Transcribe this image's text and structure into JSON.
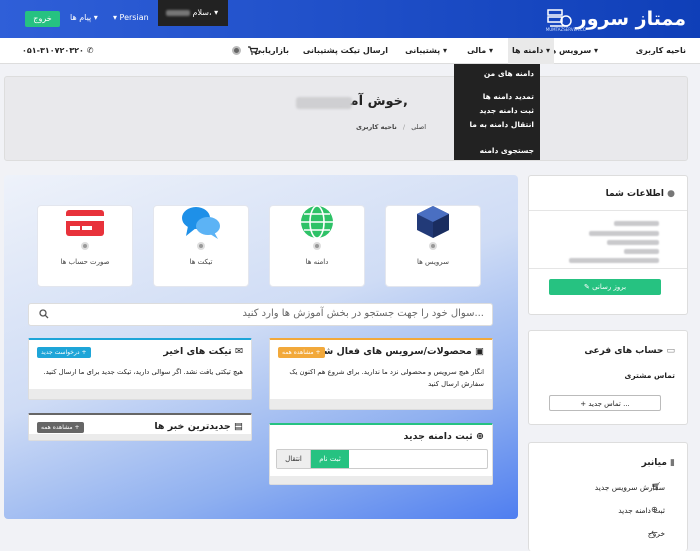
{
  "header": {
    "logo_text": "ممتاز سرور",
    "logo_subtext": "MUMTAZSERVER.CO",
    "logout_label": "خروج",
    "messages_label": "پیام ها ▾",
    "language_label": "▾ Persian"
  },
  "navbar": {
    "items": [
      "ناحیه کاربری",
      "سرویس ها ▾",
      "دامنه ها ▾",
      "مالی ▾",
      "پشتیبانی ▾",
      "ارسال تیکت پشتیبانی",
      "بازاریابی"
    ],
    "hello_label": "سلام، ▾",
    "phone": "۰۵۱-۳۱۰۷۲۰۳۲۰"
  },
  "domain_menu": {
    "items": [
      "دامنه های من",
      "تمدید دامنه ها",
      "ثبت دامنه جدید",
      "انتقال دامنه به ما",
      "جستجوی دامنه"
    ]
  },
  "hero": {
    "welcome": "خوش آمدید,",
    "breadcrumb_home": "اصلی",
    "breadcrumb_sep": "/",
    "breadcrumb_current": "ناحیه کاربری"
  },
  "tiles": [
    {
      "label": "سرویس ها",
      "icon": "cube-icon"
    },
    {
      "label": "دامنه ها",
      "icon": "globe-icon"
    },
    {
      "label": "تیکت ها",
      "icon": "chat-bubbles-icon"
    },
    {
      "label": "صورت حساب ها",
      "icon": "credit-card-icon"
    }
  ],
  "search": {
    "placeholder": "سوال خود را جهت جستجو در بخش آموزش ها وارد کنید..."
  },
  "products_card": {
    "title": "محصولات/سرویس های فعال شما",
    "badge": "مشاهده همه +",
    "body": "انگار هیچ سرویس و محصولی نزد ما ندارید. برای شروع هم اکنون یک سفارش ارسال کنید"
  },
  "tickets_card": {
    "title": "تیکت های اخیر",
    "badge": "درخواست جدید +",
    "body": "هیچ تیکتی یافت نشد. اگر سوالی دارید، تیکت جدید برای ما ارسال کنید."
  },
  "news_card": {
    "title": "جدیدترین خبر ها",
    "badge": "مشاهده همه +"
  },
  "domain_card": {
    "title": "ثبت دامنه جدید",
    "register_label": "ثبت نام",
    "transfer_label": "انتقال"
  },
  "sidebar": {
    "info_title": "اطلاعات شما",
    "update_label": "بروز رسانی",
    "contacts_title": "حساب های فرعی",
    "contact_subtitle": "تماس مشتری",
    "new_contact_label": "+ تماس جدید ...",
    "shortcuts_title": "میانبر",
    "shortcuts": [
      "سفارش سرویس جدید",
      "ثبت دامنه جدید",
      "خروج"
    ]
  },
  "colors": {
    "topbar": "#1f4fc8",
    "green": "#26c281",
    "badge_blue": "#1ea5d8",
    "badge_orange": "#f2a93b",
    "badge_gray": "#666666"
  }
}
